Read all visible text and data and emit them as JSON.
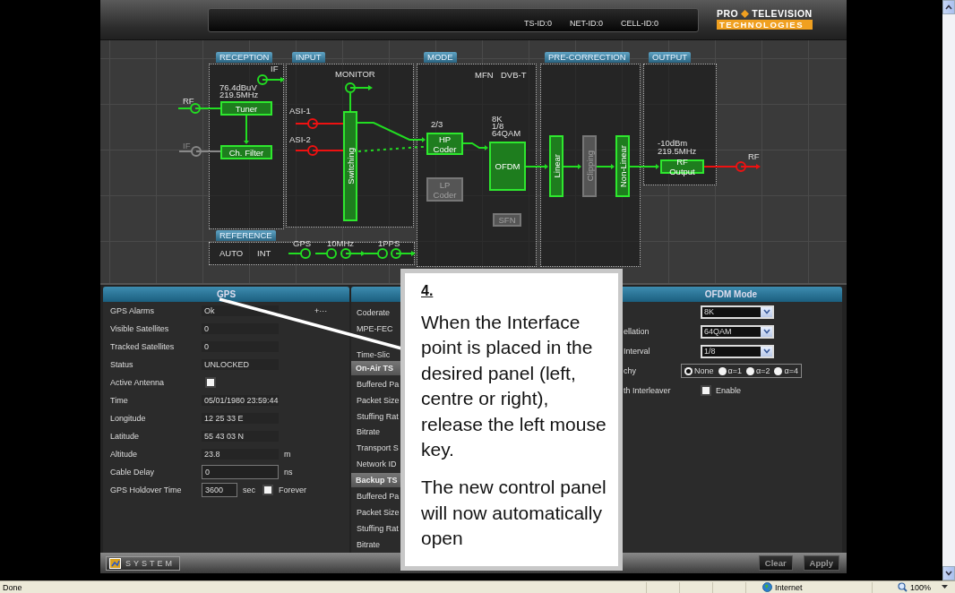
{
  "header": {
    "ids": [
      "TS-ID:0",
      "NET-ID:0",
      "CELL-ID:0"
    ],
    "logo": {
      "brand": "PRO",
      "name": "TELEVISION",
      "tagline": "TECHNOLOGIES"
    }
  },
  "diagram": {
    "sections": [
      {
        "label": "RECEPTION"
      },
      {
        "label": "INPUT"
      },
      {
        "label": "MODE"
      },
      {
        "label": "PRE-CORRECTION"
      },
      {
        "label": "OUTPUT"
      },
      {
        "label": "REFERENCE"
      }
    ],
    "texts": [
      {
        "text": "76.4dBuV",
        "dimmed": false
      },
      {
        "text": "219.5MHz",
        "dimmed": false
      },
      {
        "text": "RF",
        "dimmed": false
      },
      {
        "text": "IF",
        "dimmed": true
      },
      {
        "text": "IF",
        "dimmed": false
      },
      {
        "text": "MONITOR",
        "dimmed": false
      },
      {
        "text": "ASI-1",
        "dimmed": false
      },
      {
        "text": "ASI-2",
        "dimmed": false
      },
      {
        "text": "MFN",
        "dimmed": false
      },
      {
        "text": "DVB-T",
        "dimmed": false
      },
      {
        "text": "2/3",
        "dimmed": false
      },
      {
        "text": "8K",
        "dimmed": false
      },
      {
        "text": "1/8",
        "dimmed": false
      },
      {
        "text": "64QAM",
        "dimmed": false
      },
      {
        "text": "-10dBm",
        "dimmed": false
      },
      {
        "text": "219.5MHz",
        "dimmed": false
      },
      {
        "text": "RF",
        "dimmed": false
      },
      {
        "text": "AUTO",
        "dimmed": false
      },
      {
        "text": "INT",
        "dimmed": false
      },
      {
        "text": "GPS",
        "dimmed": false
      },
      {
        "text": "10MHz",
        "dimmed": false
      },
      {
        "text": "1PPS",
        "dimmed": false
      }
    ],
    "blocks": [
      {
        "label": "Tuner",
        "enabled": true,
        "kind": "horizontal"
      },
      {
        "label": "Ch. Filter",
        "enabled": true,
        "kind": "horizontal"
      },
      {
        "label": "Switching",
        "enabled": true,
        "kind": "vertical"
      },
      {
        "label": "HP Coder",
        "enabled": true,
        "kind": "horizontal"
      },
      {
        "label": "OFDM",
        "enabled": true,
        "kind": "horizontal"
      },
      {
        "label": "LP Coder",
        "enabled": false,
        "kind": "horizontal"
      },
      {
        "label": "SFN",
        "enabled": false,
        "kind": "horizontal"
      },
      {
        "label": "Linear",
        "enabled": true,
        "kind": "vertical"
      },
      {
        "label": "Clipping",
        "enabled": false,
        "kind": "vertical"
      },
      {
        "label": "Non-Linear",
        "enabled": true,
        "kind": "vertical"
      },
      {
        "label": "RF Output",
        "enabled": true,
        "kind": "horizontal"
      }
    ],
    "ports": [
      {
        "color": "#22dd22"
      },
      {
        "color": "#888888"
      },
      {
        "color": "#22dd22"
      },
      {
        "color": "#22dd22"
      },
      {
        "color": "#ee1111"
      },
      {
        "color": "#ee1111"
      },
      {
        "color": "#ee1111"
      },
      {
        "color": "#22dd22"
      },
      {
        "color": "#22dd22"
      },
      {
        "color": "#22dd22"
      },
      {
        "color": "#22dd22"
      },
      {
        "color": "#22dd22"
      }
    ]
  },
  "gps_panel": {
    "title": "GPS",
    "rows": [
      {
        "kind": "value",
        "label": "GPS Alarms",
        "value": "Ok",
        "note": "+···"
      },
      {
        "kind": "value",
        "label": "Visible Satellites",
        "value": "0"
      },
      {
        "kind": "value",
        "label": "Tracked Satellites",
        "value": "0"
      },
      {
        "kind": "value",
        "label": "Status",
        "value": "UNLOCKED"
      },
      {
        "kind": "checkbox",
        "label": "Active Antenna",
        "checked": false
      },
      {
        "kind": "value",
        "label": "Time",
        "value": "05/01/1980 23:59:44"
      },
      {
        "kind": "value",
        "label": "Longitude",
        "value": "12 25 33 E"
      },
      {
        "kind": "value",
        "label": "Latitude",
        "value": "55 43 03 N"
      },
      {
        "kind": "value",
        "label": "Altitude",
        "value": "23.8",
        "unit": "m"
      },
      {
        "kind": "input",
        "label": "Cable Delay",
        "value": "0",
        "unit": "ns"
      },
      {
        "kind": "input",
        "label": "GPS Holdover Time",
        "value": "3600",
        "unit": "sec",
        "option": {
          "label": "Forever",
          "checked": false
        }
      }
    ]
  },
  "middle_panel": {
    "rows": [
      {
        "kind": "field",
        "label": "Coderate"
      },
      {
        "kind": "field",
        "label": "MPE-FEC"
      },
      {
        "kind": "field",
        "label": "Time-Slic"
      },
      {
        "kind": "section",
        "label": "On-Air TS"
      },
      {
        "kind": "field",
        "label": "Buffered Pa"
      },
      {
        "kind": "field",
        "label": "Packet Size"
      },
      {
        "kind": "field",
        "label": "Stuffing Rat"
      },
      {
        "kind": "field",
        "label": "Bitrate"
      },
      {
        "kind": "field",
        "label": "Transport S"
      },
      {
        "kind": "field",
        "label": "Network ID"
      },
      {
        "kind": "section",
        "label": "Backup TS"
      },
      {
        "kind": "field",
        "label": "Buffered Pa"
      },
      {
        "kind": "field",
        "label": "Packet Size"
      },
      {
        "kind": "field",
        "label": "Stuffing Rat"
      },
      {
        "kind": "field",
        "label": "Bitrate"
      }
    ]
  },
  "ofdm_panel": {
    "title": "OFDM Mode",
    "rows": [
      {
        "kind": "select",
        "value": "8K"
      },
      {
        "kind": "select",
        "label": "ellation",
        "value": "64QAM"
      },
      {
        "kind": "select",
        "label": "Interval",
        "value": "1/8"
      },
      {
        "kind": "radio",
        "label": "chy",
        "options": [
          {
            "label": "None",
            "selected": true
          },
          {
            "label": "α=1",
            "selected": false
          },
          {
            "label": "α=2",
            "selected": false
          },
          {
            "label": "α=4",
            "selected": false
          }
        ]
      },
      {
        "kind": "checkbox",
        "label": "th Interleaver",
        "checked": false,
        "text": "Enable"
      }
    ]
  },
  "bottom_bar": {
    "system_button": "SYSTEM",
    "buttons": [
      "Clear",
      "Apply"
    ]
  },
  "callout": {
    "step": "4.",
    "paragraphs": [
      "When the Interface point is placed in the desired panel (left, centre or right), release the left mouse key.",
      "The new control panel will now automatically open"
    ]
  },
  "status_bar": {
    "status": "Done",
    "zone": "Internet",
    "zoom": "100%"
  }
}
